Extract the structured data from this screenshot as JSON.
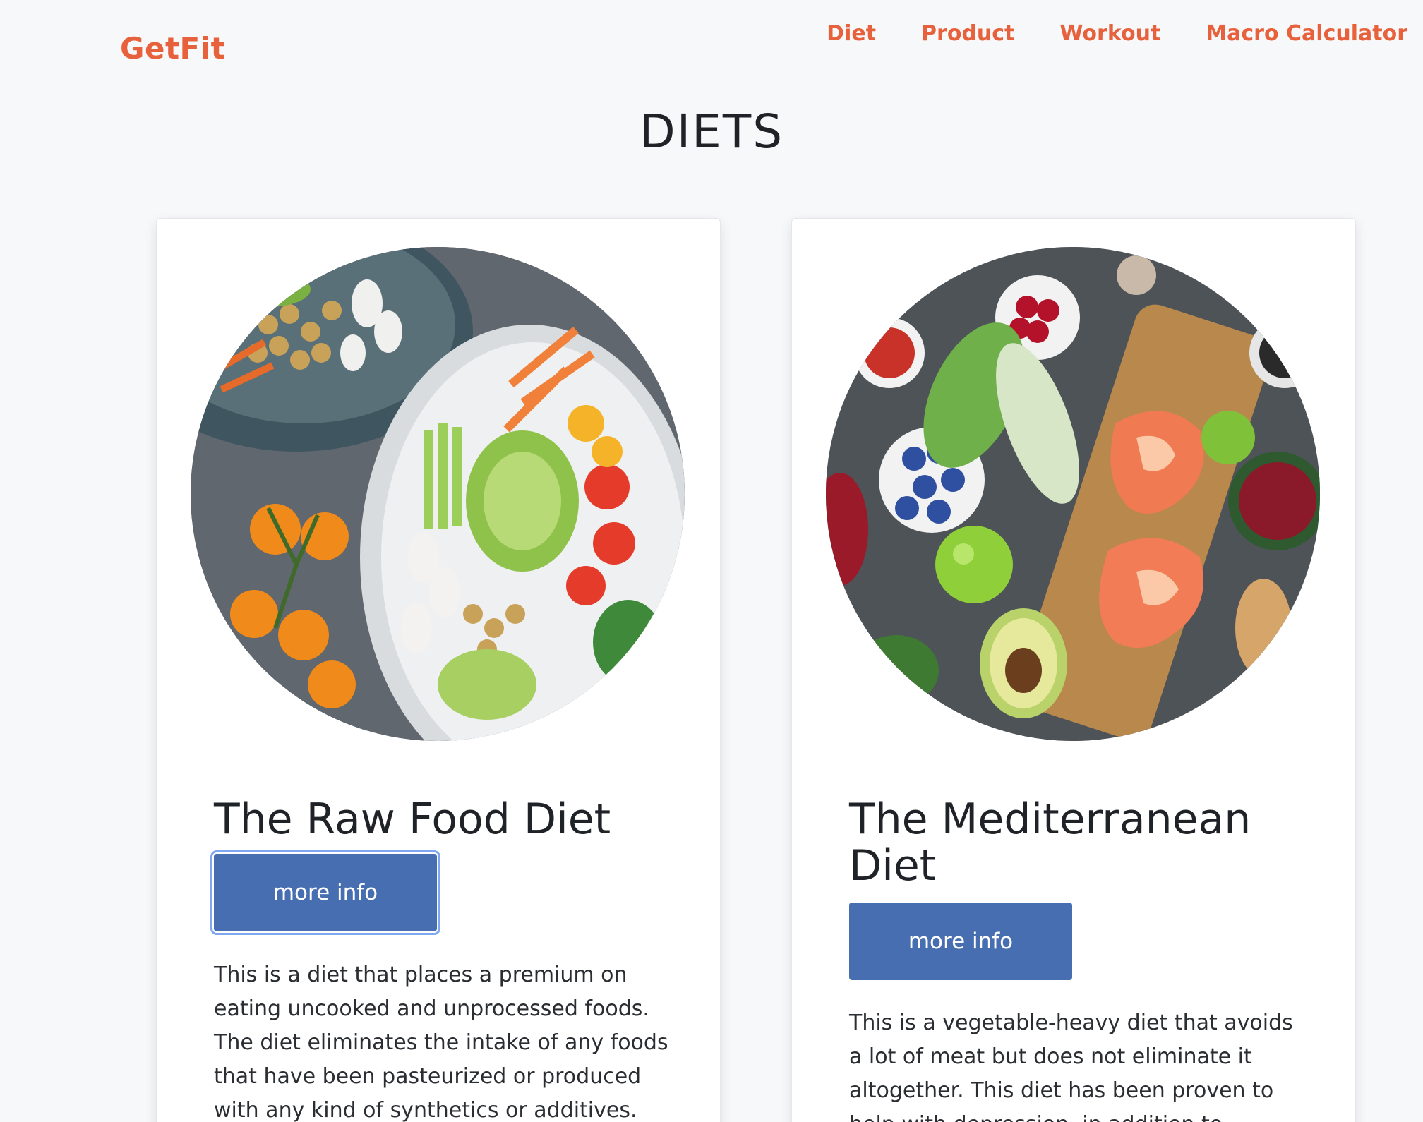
{
  "header": {
    "brand": "GetFit",
    "nav": [
      "Diet",
      "Product",
      "Workout",
      "Macro Calculator"
    ]
  },
  "main": {
    "title": "DIETS",
    "cards": [
      {
        "title": "The Raw Food Diet",
        "button": "more info",
        "description": "This is a diet that places a premium on eating uncooked and unprocessed foods. The diet eliminates the intake of any foods that have been pasteurized or produced with any kind of synthetics or additives."
      },
      {
        "title": "The Mediterranean Diet",
        "button": "more info",
        "description": "This is a vegetable-heavy diet that avoids a lot of meat but does not eliminate it altogether. This diet has been proven to help with depression, in addition to"
      }
    ]
  },
  "colors": {
    "accent": "#e7623c",
    "button": "#476eb1",
    "background": "#f7f8fa"
  }
}
